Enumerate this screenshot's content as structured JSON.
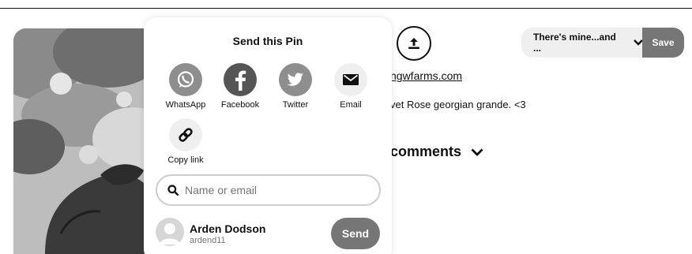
{
  "popup": {
    "title": "Send this Pin",
    "share_options": [
      {
        "label": "WhatsApp",
        "icon": "whatsapp-icon",
        "color": "#8e8e8e"
      },
      {
        "label": "Facebook",
        "icon": "facebook-icon",
        "color": "#555555"
      },
      {
        "label": "Twitter",
        "icon": "twitter-icon",
        "color": "#8e8e8e"
      },
      {
        "label": "Email",
        "icon": "email-icon",
        "color": "#efefef"
      },
      {
        "label": "Copy link",
        "icon": "link-icon",
        "color": "#efefef"
      }
    ],
    "search": {
      "placeholder": "Name or email"
    },
    "contact": {
      "name": "Arden Dodson",
      "username": "ardend11",
      "send_label": "Send"
    }
  },
  "pin": {
    "board_select_label": "There's mine...and ...",
    "save_label": "Save",
    "source_link": "ngwfarms.com",
    "description": "vet Rose georgian grande. <3",
    "comments_label": "comments"
  },
  "colors": {
    "save_button": "#767676",
    "send_button": "#767676",
    "select_bg": "#efefef"
  }
}
